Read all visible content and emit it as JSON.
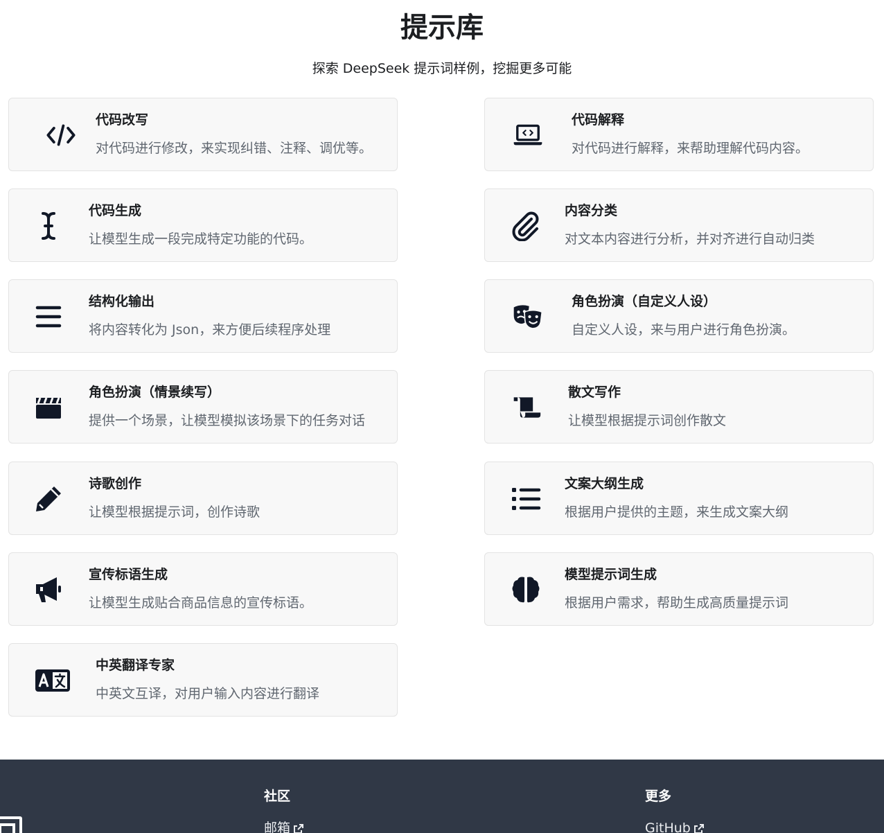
{
  "header": {
    "title": "提示库",
    "subtitle": "探索 DeepSeek 提示词样例，挖掘更多可能"
  },
  "cards": [
    {
      "title": "代码改写",
      "desc": "对代码进行修改，来实现纠错、注释、调优等。",
      "icon": "code-icon"
    },
    {
      "title": "代码解释",
      "desc": "对代码进行解释，来帮助理解代码内容。",
      "icon": "laptop-code-icon"
    },
    {
      "title": "代码生成",
      "desc": "让模型生成一段完成特定功能的代码。",
      "icon": "text-cursor-icon"
    },
    {
      "title": "内容分类",
      "desc": "对文本内容进行分析，并对齐进行自动归类",
      "icon": "paperclip-icon"
    },
    {
      "title": "结构化输出",
      "desc": "将内容转化为 Json，来方便后续程序处理",
      "icon": "bars-icon"
    },
    {
      "title": "角色扮演（自定义人设）",
      "desc": "自定义人设，来与用户进行角色扮演。",
      "icon": "masks-theater-icon"
    },
    {
      "title": "角色扮演（情景续写）",
      "desc": "提供一个场景，让模型模拟该场景下的任务对话",
      "icon": "clapperboard-icon"
    },
    {
      "title": "散文写作",
      "desc": "让模型根据提示词创作散文",
      "icon": "scroll-icon"
    },
    {
      "title": "诗歌创作",
      "desc": "让模型根据提示词，创作诗歌",
      "icon": "pencil-icon"
    },
    {
      "title": "文案大纲生成",
      "desc": "根据用户提供的主题，来生成文案大纲",
      "icon": "list-icon"
    },
    {
      "title": "宣传标语生成",
      "desc": "让模型生成贴合商品信息的宣传标语。",
      "icon": "bullhorn-icon"
    },
    {
      "title": "模型提示词生成",
      "desc": "根据用户需求，帮助生成高质量提示词",
      "icon": "brain-icon"
    },
    {
      "title": "中英翻译专家",
      "desc": "中英文互译，对用户输入内容进行翻译",
      "icon": "language-icon"
    }
  ],
  "footer": {
    "community_heading": "社区",
    "community_link": "邮箱",
    "more_heading": "更多",
    "more_link": "GitHub"
  },
  "colors": {
    "card_background": "#f8f8f8",
    "card_border": "#e3e3e3",
    "icon": "#111827",
    "footer_background": "#303846"
  }
}
